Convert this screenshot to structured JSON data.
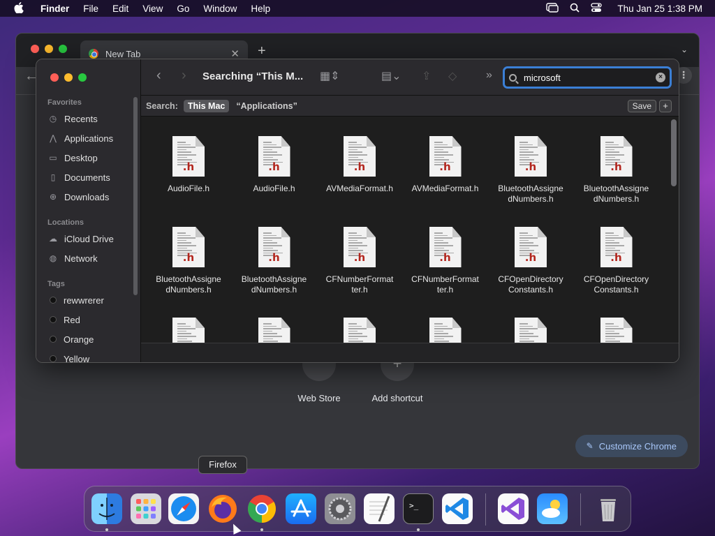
{
  "menubar": {
    "app_name": "Finder",
    "menus": [
      "File",
      "Edit",
      "View",
      "Go",
      "Window",
      "Help"
    ],
    "status_icons": [
      "screen-mirroring-icon",
      "spotlight-search-icon",
      "control-center-icon"
    ],
    "clock": "Thu Jan 25  1:38 PM"
  },
  "chrome": {
    "tab_title": "New Tab",
    "shortcuts": [
      {
        "label": "Web Store",
        "icon": "web-store-icon"
      },
      {
        "label": "Add shortcut",
        "icon": "plus-icon"
      }
    ],
    "customize_label": "Customize Chrome"
  },
  "finder": {
    "title": "Searching “This M...",
    "sidebar": {
      "favorites_label": "Favorites",
      "favorites": [
        {
          "label": "Recents",
          "icon": "clock-icon"
        },
        {
          "label": "Applications",
          "icon": "applications-icon"
        },
        {
          "label": "Desktop",
          "icon": "desktop-icon"
        },
        {
          "label": "Documents",
          "icon": "document-icon"
        },
        {
          "label": "Downloads",
          "icon": "download-icon"
        }
      ],
      "locations_label": "Locations",
      "locations": [
        {
          "label": "iCloud Drive",
          "icon": "cloud-icon"
        },
        {
          "label": "Network",
          "icon": "network-icon"
        }
      ],
      "tags_label": "Tags",
      "tags": [
        {
          "label": "rewwrerer"
        },
        {
          "label": "Red"
        },
        {
          "label": "Orange"
        },
        {
          "label": "Yellow"
        }
      ]
    },
    "search": {
      "value": "microsoft"
    },
    "scope": {
      "label": "Search:",
      "this_mac": "This Mac",
      "applications": "“Applications”",
      "save": "Save",
      "add": "+"
    },
    "file_extension": ".h",
    "files": [
      {
        "l1": "AudioFile.h",
        "l2": ""
      },
      {
        "l1": "AudioFile.h",
        "l2": ""
      },
      {
        "l1": "AVMediaFormat.h",
        "l2": ""
      },
      {
        "l1": "AVMediaFormat.h",
        "l2": ""
      },
      {
        "l1": "BluetoothAssigne",
        "l2": "dNumbers.h"
      },
      {
        "l1": "BluetoothAssigne",
        "l2": "dNumbers.h"
      },
      {
        "l1": "BluetoothAssigne",
        "l2": "dNumbers.h"
      },
      {
        "l1": "BluetoothAssigne",
        "l2": "dNumbers.h"
      },
      {
        "l1": "CFNumberFormat",
        "l2": "ter.h"
      },
      {
        "l1": "CFNumberFormat",
        "l2": "ter.h"
      },
      {
        "l1": "CFOpenDirectory",
        "l2": "Constants.h"
      },
      {
        "l1": "CFOpenDirectory",
        "l2": "Constants.h"
      }
    ]
  },
  "dock": {
    "tooltip": "Firefox",
    "apps": [
      "Finder",
      "Launchpad",
      "Safari",
      "Firefox",
      "Google Chrome",
      "App Store",
      "System Settings",
      "TextEdit",
      "Terminal",
      "Visual Studio Code",
      "Visual Studio",
      "Weather",
      "Trash"
    ]
  }
}
